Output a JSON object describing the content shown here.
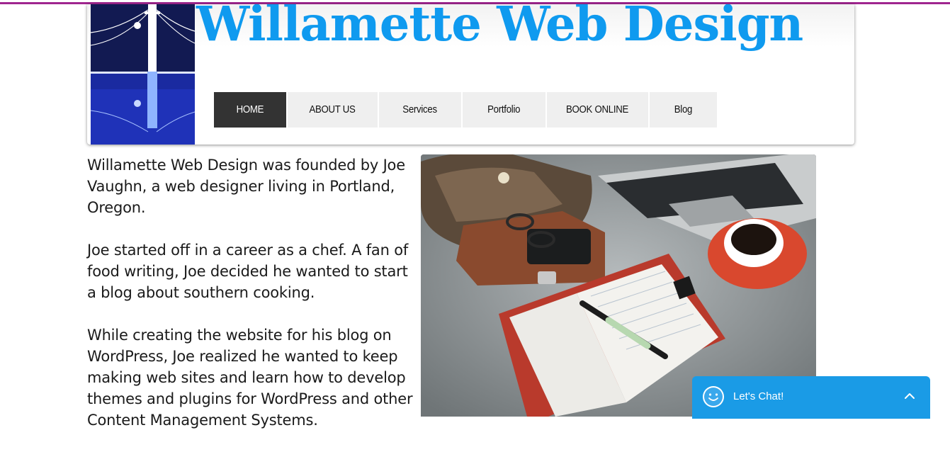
{
  "site": {
    "title": "Willamette Web Design"
  },
  "nav": {
    "items": [
      {
        "label": "HOME",
        "active": true
      },
      {
        "label": "ABOUT US",
        "active": false
      },
      {
        "label": "Services",
        "active": false
      },
      {
        "label": "Portfolio",
        "active": false
      },
      {
        "label": "BOOK ONLINE",
        "active": false
      },
      {
        "label": "Blog",
        "active": false
      }
    ]
  },
  "content": {
    "paragraphs": [
      "Willamette Web Design was founded by Joe Vaughn, a web designer living in Portland, Oregon.",
      "Joe started off in a career as a chef. A fan of food writing, Joe decided he wanted to start a blog about southern cooking.",
      "While creating the website for his blog on WordPress, Joe realized he wanted to keep making web sites and learn how to develop themes and plugins for WordPress and other Content Management Systems."
    ]
  },
  "chat": {
    "label": "Let's Chat!",
    "icon": "smiley-icon",
    "toggle_icon": "chevron-up-icon"
  },
  "colors": {
    "title": "#0f9aef",
    "accent_line": "#a0268f",
    "nav_active_bg": "#333333",
    "nav_bg": "#efefef",
    "chat_bg": "#1a9be6"
  }
}
